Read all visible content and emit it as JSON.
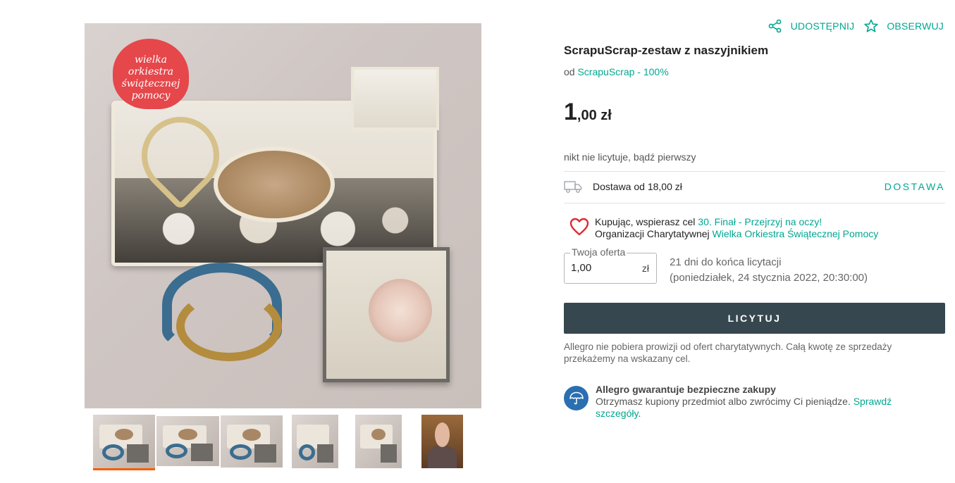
{
  "gallery": {
    "badge_text": [
      "wielka orkiestra",
      "świątecznej",
      "pomocy"
    ],
    "thumbnails": [
      "thumb-1",
      "thumb-2",
      "thumb-3",
      "thumb-4",
      "thumb-5",
      "thumb-6"
    ],
    "active_index": 0
  },
  "actions": {
    "share_label": "UDOSTĘPNIJ",
    "watch_label": "OBSERWUJ"
  },
  "product": {
    "title": "ScrapuScrap-zestaw z naszyjnikiem",
    "seller_prefix": "od",
    "seller_name": "ScrapuScrap - 100%",
    "price_main": "1",
    "price_rest": ",00 zł",
    "bid_info": "nikt nie licytuje, bądź pierwszy"
  },
  "delivery": {
    "text": "Dostawa od 18,00 zł",
    "link": "DOSTAWA"
  },
  "charity": {
    "prefix": "Kupując, wspierasz cel",
    "goal_link": "30. Finał - Przejrzyj na oczy!",
    "org_prefix": "Organizacji Charytatywnej",
    "org_link": "Wielka Orkiestra Świątecznej Pomocy"
  },
  "offer": {
    "label": "Twoja oferta",
    "value": "1,00",
    "currency": "zł",
    "time_left": "21 dni do końca licytacji",
    "end_date": "(poniedziałek, 24 stycznia 2022, 20:30:00)"
  },
  "bid_button": "LICYTUJ",
  "commission_note": "Allegro nie pobiera prowizji od ofert charytatywnych. Całą kwotę ze sprzedaży przekażemy na wskazany cel.",
  "guarantee": {
    "title": "Allegro gwarantuje bezpieczne zakupy",
    "text": "Otrzymasz kupiony przedmiot albo zwrócimy Ci pieniądze.",
    "link": "Sprawdź szczegóły",
    "suffix": "."
  },
  "colors": {
    "accent": "#00a790",
    "button_bg": "#37474f",
    "active_thumb": "#ff5a00",
    "charity_heart": "#e2292f",
    "guarantee_icon": "#2a6fb0"
  }
}
